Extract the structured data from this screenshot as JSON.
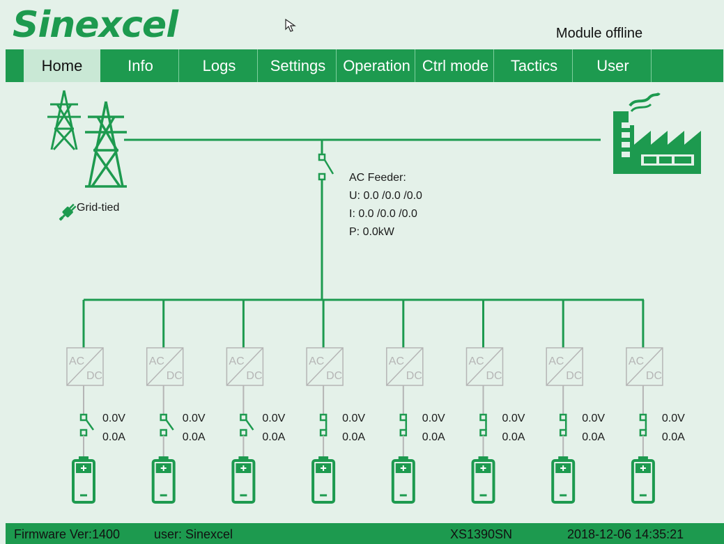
{
  "header": {
    "logo": "Sinexcel",
    "status": "Module offline"
  },
  "nav": {
    "tabs": [
      {
        "label": "Home",
        "active": true
      },
      {
        "label": "Info"
      },
      {
        "label": "Logs"
      },
      {
        "label": "Settings"
      },
      {
        "label": "Operation"
      },
      {
        "label": "Ctrl mode"
      },
      {
        "label": "Tactics"
      },
      {
        "label": "User"
      }
    ]
  },
  "diagram": {
    "grid_label": "Grid-tied",
    "feeder": {
      "title": "AC Feeder:",
      "voltage": "U: 0.0 /0.0 /0.0",
      "current": "I: 0.0 /0.0 /0.0",
      "power": "P: 0.0kW"
    },
    "converter": {
      "ac": "AC",
      "dc": "DC"
    },
    "modules": [
      {
        "voltage": "0.0V",
        "current": "0.0A",
        "switch": "open"
      },
      {
        "voltage": "0.0V",
        "current": "0.0A",
        "switch": "open"
      },
      {
        "voltage": "0.0V",
        "current": "0.0A",
        "switch": "open"
      },
      {
        "voltage": "0.0V",
        "current": "0.0A",
        "switch": "closed"
      },
      {
        "voltage": "0.0V",
        "current": "0.0A",
        "switch": "closed"
      },
      {
        "voltage": "0.0V",
        "current": "0.0A",
        "switch": "closed"
      },
      {
        "voltage": "0.0V",
        "current": "0.0A",
        "switch": "closed"
      },
      {
        "voltage": "0.0V",
        "current": "0.0A",
        "switch": "closed"
      }
    ]
  },
  "footer": {
    "firmware": "Firmware Ver:1400",
    "user": "user: Sinexcel",
    "serial": "XS1390SN",
    "datetime": "2018-12-06 14:35:21"
  },
  "colors": {
    "accent": "#1d9a4f",
    "background": "#e4f1e9",
    "converter": "#b5b5b5"
  },
  "icons": [
    "pylon-icon",
    "factory-icon",
    "plug-icon",
    "battery-icon",
    "switch-icon",
    "converter-icon",
    "cursor-icon"
  ]
}
